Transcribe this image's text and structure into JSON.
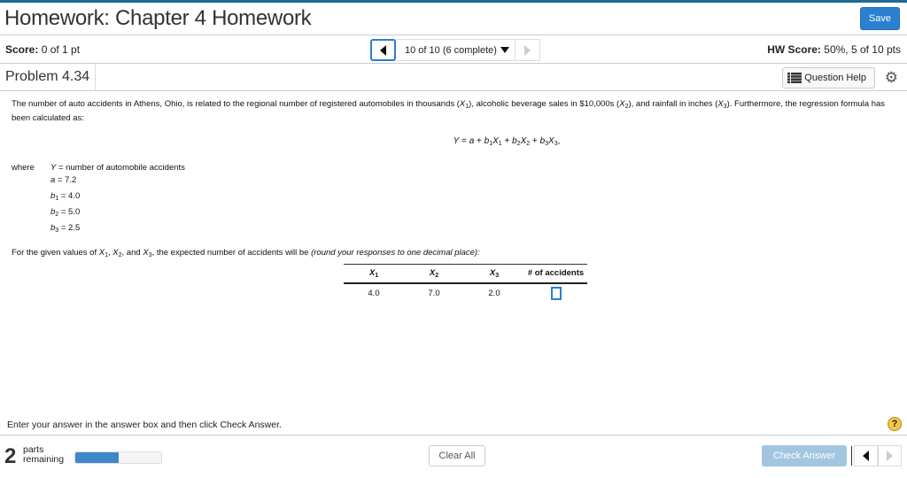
{
  "header": {
    "title": "Homework: Chapter 4 Homework",
    "save_label": "Save"
  },
  "score": {
    "label": "Score:",
    "value": "0 of 1 pt",
    "nav_text": "10 of 10 (6 complete)",
    "hw_label": "HW Score:",
    "hw_value": "50%, 5 of 10 pts"
  },
  "problem": {
    "title": "Problem 4.34",
    "question_help": "Question Help"
  },
  "content": {
    "intro": [
      "The number of auto accidents in Athens, Ohio, is related to the regional number of registered automobiles in thousands (",
      "X",
      "1",
      "), alcoholic beverage sales in $10,000s (",
      "X",
      "2",
      "), and rainfall in inches (",
      "X",
      "3",
      "). Furthermore, the regression formula has been calculated as:"
    ],
    "equation": [
      "Y",
      " = ",
      "a",
      " + ",
      "b",
      "1",
      "X",
      "1",
      " + ",
      "b",
      "2",
      "X",
      "2",
      " + ",
      "b",
      "3",
      "X",
      "3",
      ","
    ],
    "where": "where",
    "defs": [
      {
        "sym": "Y",
        "sub": "",
        "val": " = number of automobile accidents"
      },
      {
        "sym": "a",
        "sub": "",
        "val": " = 7.2"
      },
      {
        "sym": "b",
        "sub": "1",
        "val": " = 4.0"
      },
      {
        "sym": "b",
        "sub": "2",
        "val": " = 5.0"
      },
      {
        "sym": "b",
        "sub": "3",
        "val": " = 2.5"
      }
    ],
    "given": [
      "For the given values of ",
      "X",
      "1",
      ", ",
      "X",
      "2",
      ", and ",
      "X",
      "3",
      ", the expected number of accidents will be ",
      "(round your responses to one decimal place):"
    ],
    "table": {
      "headers": [
        {
          "sym": "X",
          "sub": "1"
        },
        {
          "sym": "X",
          "sub": "2"
        },
        {
          "sym": "X",
          "sub": "3"
        },
        {
          "sym": "# of accidents",
          "sub": ""
        }
      ],
      "row": [
        "4.0",
        "7.0",
        "2.0"
      ],
      "answer": ""
    }
  },
  "instruction": "Enter your answer in the answer box and then click Check Answer.",
  "footer": {
    "parts_count": "2",
    "parts_line1": "parts",
    "parts_line2": "remaining",
    "parts_progress_fraction": 0.5,
    "clear_all": "Clear All",
    "check_answer": "Check Answer"
  },
  "colors": {
    "accent": "#2a7fd0",
    "top_bar": "#1f6b8f",
    "check_disabled": "#a2c6e0",
    "progress": "#3f87c8"
  }
}
